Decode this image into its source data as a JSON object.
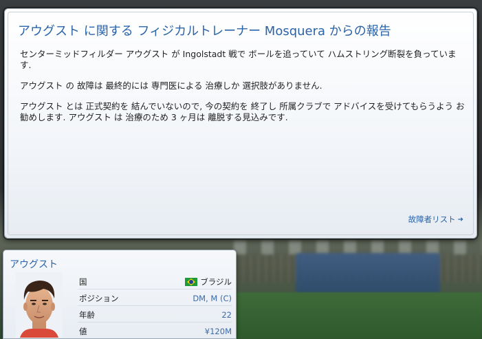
{
  "report": {
    "title": "アウグスト に関する フィジカルトレーナー Mosquera からの報告",
    "paragraphs": [
      "センターミッドフィルダー アウグスト が Ingolstadt 戦で ボールを追っていて ハムストリング断裂を負っています.",
      "アウグスト の 故障は 最終的には 専門医による 治療しか 選択肢がありません.",
      "アウグスト とは 正式契約を 結んでいないので, 今の契約を 終了し 所属クラブで アドバイスを受けてもらうよう お勧めします. アウグスト は 治療のため 3 ヶ月は 離脱する見込みです."
    ],
    "injury_list_link": "故障者リスト",
    "link_icon": "arrow-right-icon"
  },
  "player": {
    "name": "アウグスト",
    "attributes": [
      {
        "label": "国",
        "value": "ブラジル",
        "icon": "brazil-flag-icon"
      },
      {
        "label": "ポジション",
        "value": "DM, M (C)"
      },
      {
        "label": "年齢",
        "value": "22"
      },
      {
        "label": "値",
        "value": "¥120M"
      }
    ]
  },
  "colors": {
    "accent": "#2a63a8",
    "text": "#1f1f1f"
  }
}
